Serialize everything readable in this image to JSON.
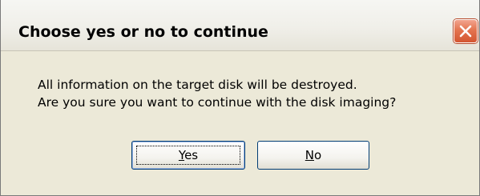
{
  "dialog": {
    "title": "Choose yes or no to continue",
    "message_line1": "All information on the target disk will be destroyed.",
    "message_line2": "Are you sure you want to continue with the disk imaging?"
  },
  "buttons": {
    "yes": {
      "mnemonic": "Y",
      "rest": "es"
    },
    "no": {
      "mnemonic": "N",
      "rest": "o"
    }
  },
  "icons": {
    "close": "close-icon"
  },
  "colors": {
    "dialog_background": "#ece9d8",
    "close_button": "#e4744f",
    "button_border": "#003c74"
  }
}
